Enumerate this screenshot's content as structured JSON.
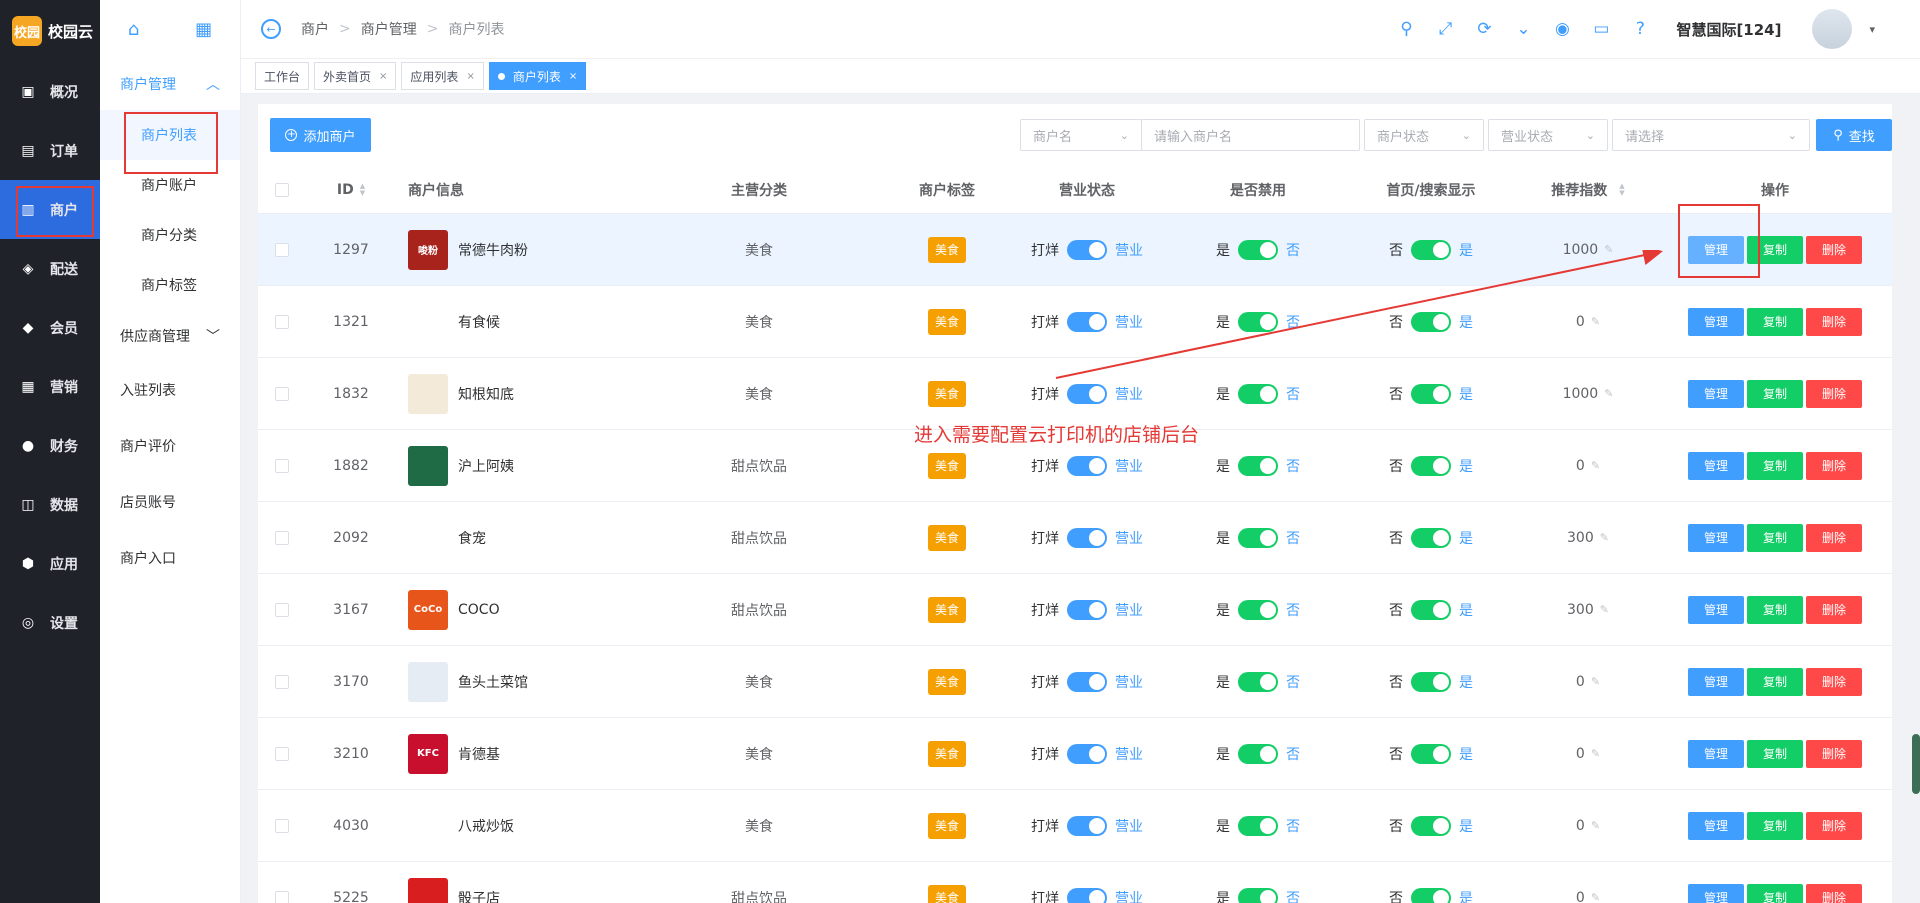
{
  "brand": {
    "logo_text": "校园",
    "name": "校园云"
  },
  "rail": [
    {
      "label": "概况",
      "icon": "dashboard-icon"
    },
    {
      "label": "订单",
      "icon": "order-icon"
    },
    {
      "label": "商户",
      "icon": "store-icon",
      "active": true
    },
    {
      "label": "配送",
      "icon": "delivery-icon"
    },
    {
      "label": "会员",
      "icon": "member-icon"
    },
    {
      "label": "营销",
      "icon": "marketing-icon"
    },
    {
      "label": "财务",
      "icon": "finance-icon"
    },
    {
      "label": "数据",
      "icon": "data-icon"
    },
    {
      "label": "应用",
      "icon": "app-icon"
    },
    {
      "label": "设置",
      "icon": "settings-icon"
    }
  ],
  "subnav": {
    "group_open": "商户管理",
    "children": [
      "商户列表",
      "商户账户",
      "商户分类",
      "商户标签"
    ],
    "group_collapsed": "供应商管理",
    "links": [
      "入驻列表",
      "商户评价",
      "店员账号",
      "商户入口"
    ]
  },
  "header": {
    "breadcrumbs": [
      "商户",
      "商户管理",
      "商户列表"
    ],
    "org_name": "智慧国际[124]"
  },
  "tabs": [
    {
      "label": "工作台",
      "closable": false
    },
    {
      "label": "外卖首页",
      "closable": true
    },
    {
      "label": "应用列表",
      "closable": true
    },
    {
      "label": "商户列表",
      "closable": true,
      "active": true
    }
  ],
  "toolbar": {
    "add_label": "添加商户",
    "filter_field": "商户名",
    "name_placeholder": "请输入商户名",
    "status_placeholder": "商户状态",
    "business_placeholder": "营业状态",
    "select_placeholder": "请选择",
    "search_label": "查找"
  },
  "columns": {
    "id": "ID",
    "info": "商户信息",
    "category": "主营分类",
    "tag": "商户标签",
    "business": "营业状态",
    "disabled": "是否禁用",
    "home": "首页/搜索显示",
    "rec": "推荐指数",
    "ops": "操作"
  },
  "switch_labels": {
    "business_left": "打烊",
    "business_right": "营业",
    "disabled_left": "是",
    "disabled_right": "否",
    "home_left": "否",
    "home_right": "是"
  },
  "ops_labels": {
    "manage": "管理",
    "copy": "复制",
    "delete": "删除"
  },
  "rows": [
    {
      "id": "1297",
      "name": "常德牛肉粉",
      "category": "美食",
      "tag": "美食",
      "rec": "1000",
      "logo_text": "唆粉",
      "logo_color": "#a8231c"
    },
    {
      "id": "1321",
      "name": "有食候",
      "category": "美食",
      "tag": "美食",
      "rec": "0",
      "logo_text": "",
      "logo_color": "#ffffff"
    },
    {
      "id": "1832",
      "name": "知根知底",
      "category": "美食",
      "tag": "美食",
      "rec": "1000",
      "logo_text": "",
      "logo_color": "#f3ead9"
    },
    {
      "id": "1882",
      "name": "沪上阿姨",
      "category": "甜点饮品",
      "tag": "美食",
      "rec": "0",
      "logo_text": "",
      "logo_color": "#1f6b45"
    },
    {
      "id": "2092",
      "name": "食宠",
      "category": "甜点饮品",
      "tag": "美食",
      "rec": "300",
      "logo_text": "",
      "logo_color": "#ffffff"
    },
    {
      "id": "3167",
      "name": "COCO",
      "category": "甜点饮品",
      "tag": "美食",
      "rec": "300",
      "logo_text": "CoCo",
      "logo_color": "#e8551a"
    },
    {
      "id": "3170",
      "name": "鱼头土菜馆",
      "category": "美食",
      "tag": "美食",
      "rec": "0",
      "logo_text": "",
      "logo_color": "#e6ecf3"
    },
    {
      "id": "3210",
      "name": "肯德基",
      "category": "美食",
      "tag": "美食",
      "rec": "0",
      "logo_text": "KFC",
      "logo_color": "#c8102e"
    },
    {
      "id": "4030",
      "name": "八戒炒饭",
      "category": "美食",
      "tag": "美食",
      "rec": "0",
      "logo_text": "",
      "logo_color": "#ffffff"
    },
    {
      "id": "5225",
      "name": "骰子店",
      "category": "甜点饮品",
      "tag": "美食",
      "rec": "0",
      "logo_text": "",
      "logo_color": "#d81e1e"
    }
  ],
  "annotation": {
    "text": "进入需要配置云打印机的店铺后台"
  },
  "colors": {
    "primary": "#409eff",
    "success": "#13ce66",
    "danger": "#ff4949",
    "tag": "#f5a000",
    "rail": "#1f2329"
  }
}
